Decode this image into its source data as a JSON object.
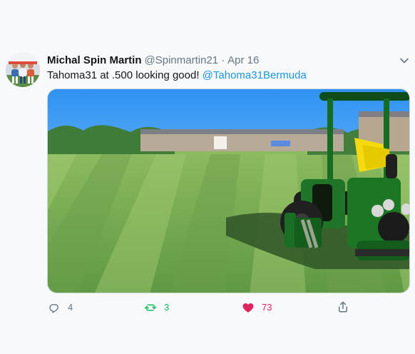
{
  "tweet": {
    "author_name": "Michal Spin Martin",
    "author_handle": "@Spinmartin21",
    "separator": "·",
    "date": "Apr 16",
    "text_prefix": "Tahoma31 at .500 looking good! ",
    "mention": "@Tahoma31Bermuda",
    "image_alt": "Freshly mown striped field with green reel mower",
    "stats": {
      "replies": "4",
      "retweets": "3",
      "likes": "73"
    }
  },
  "icons": {
    "menu": "chevron-down-icon",
    "reply": "reply-icon",
    "retweet": "retweet-icon",
    "like": "heart-icon",
    "share": "share-icon"
  },
  "colors": {
    "background": "#f7f9fa",
    "text": "#14171a",
    "muted": "#657786",
    "link": "#1b95e0",
    "retweet": "#17bf63",
    "like": "#e0245e",
    "border": "#ccd6dd"
  }
}
